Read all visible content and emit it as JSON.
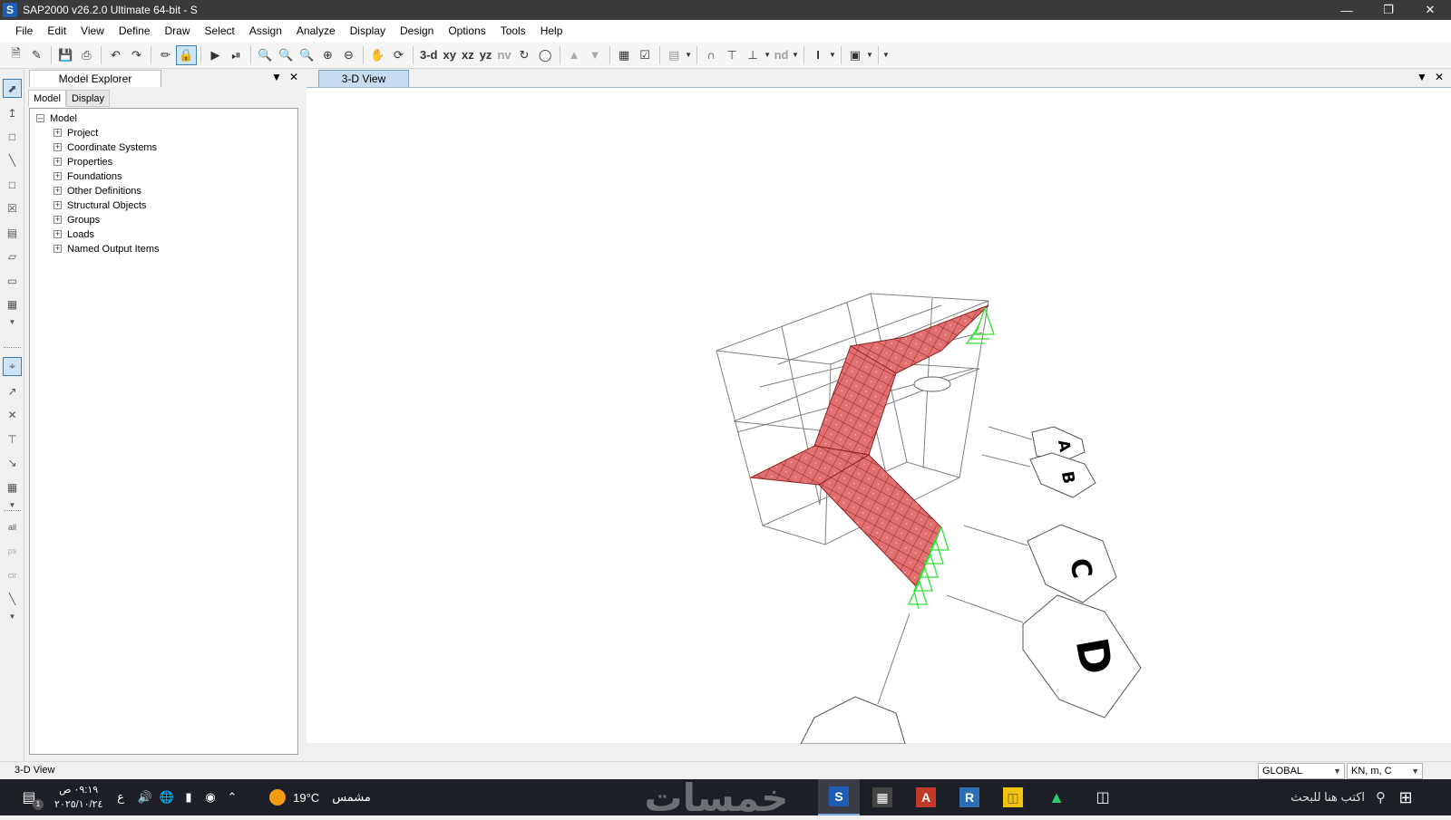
{
  "window": {
    "title": "SAP2000 v26.2.0 Ultimate 64-bit - S",
    "app_icon_letter": "S",
    "controls": [
      "minimize-icon",
      "restore-icon",
      "close-icon"
    ]
  },
  "menu": [
    "File",
    "Edit",
    "View",
    "Define",
    "Draw",
    "Select",
    "Assign",
    "Analyze",
    "Display",
    "Design",
    "Options",
    "Tools",
    "Help"
  ],
  "toolbar": {
    "view_3d": "3-d",
    "view_xy": "xy",
    "view_xz": "xz",
    "view_yz": "yz",
    "view_nv": "nv",
    "nd": "nd"
  },
  "explorer": {
    "title": "Model Explorer",
    "tabs": [
      "Model",
      "Display"
    ],
    "root": "Model",
    "items": [
      "Project",
      "Coordinate Systems",
      "Properties",
      "Foundations",
      "Other Definitions",
      "Structural Objects",
      "Groups",
      "Loads",
      "Named Output Items"
    ]
  },
  "view": {
    "tab_title": "3-D View",
    "grid_labels": [
      "A",
      "B",
      "C",
      "D"
    ],
    "colors": {
      "shell": "#c0392b",
      "shell_fill": "#e06b6b",
      "restraint": "#33e033",
      "grid": "#777777"
    }
  },
  "status": {
    "text": "3-D View",
    "coord_system": "GLOBAL",
    "units": "KN, m, C"
  },
  "taskbar": {
    "time": "٠٩:١٩ ص",
    "date": "٢٠٢٥/١٠/٢٤",
    "lang": "ع",
    "weather_temp": "19°C",
    "weather_text": "مشمس",
    "search_placeholder": "اكتب هنا للبحث",
    "watermark": "خمسات",
    "notification_count": "1"
  }
}
